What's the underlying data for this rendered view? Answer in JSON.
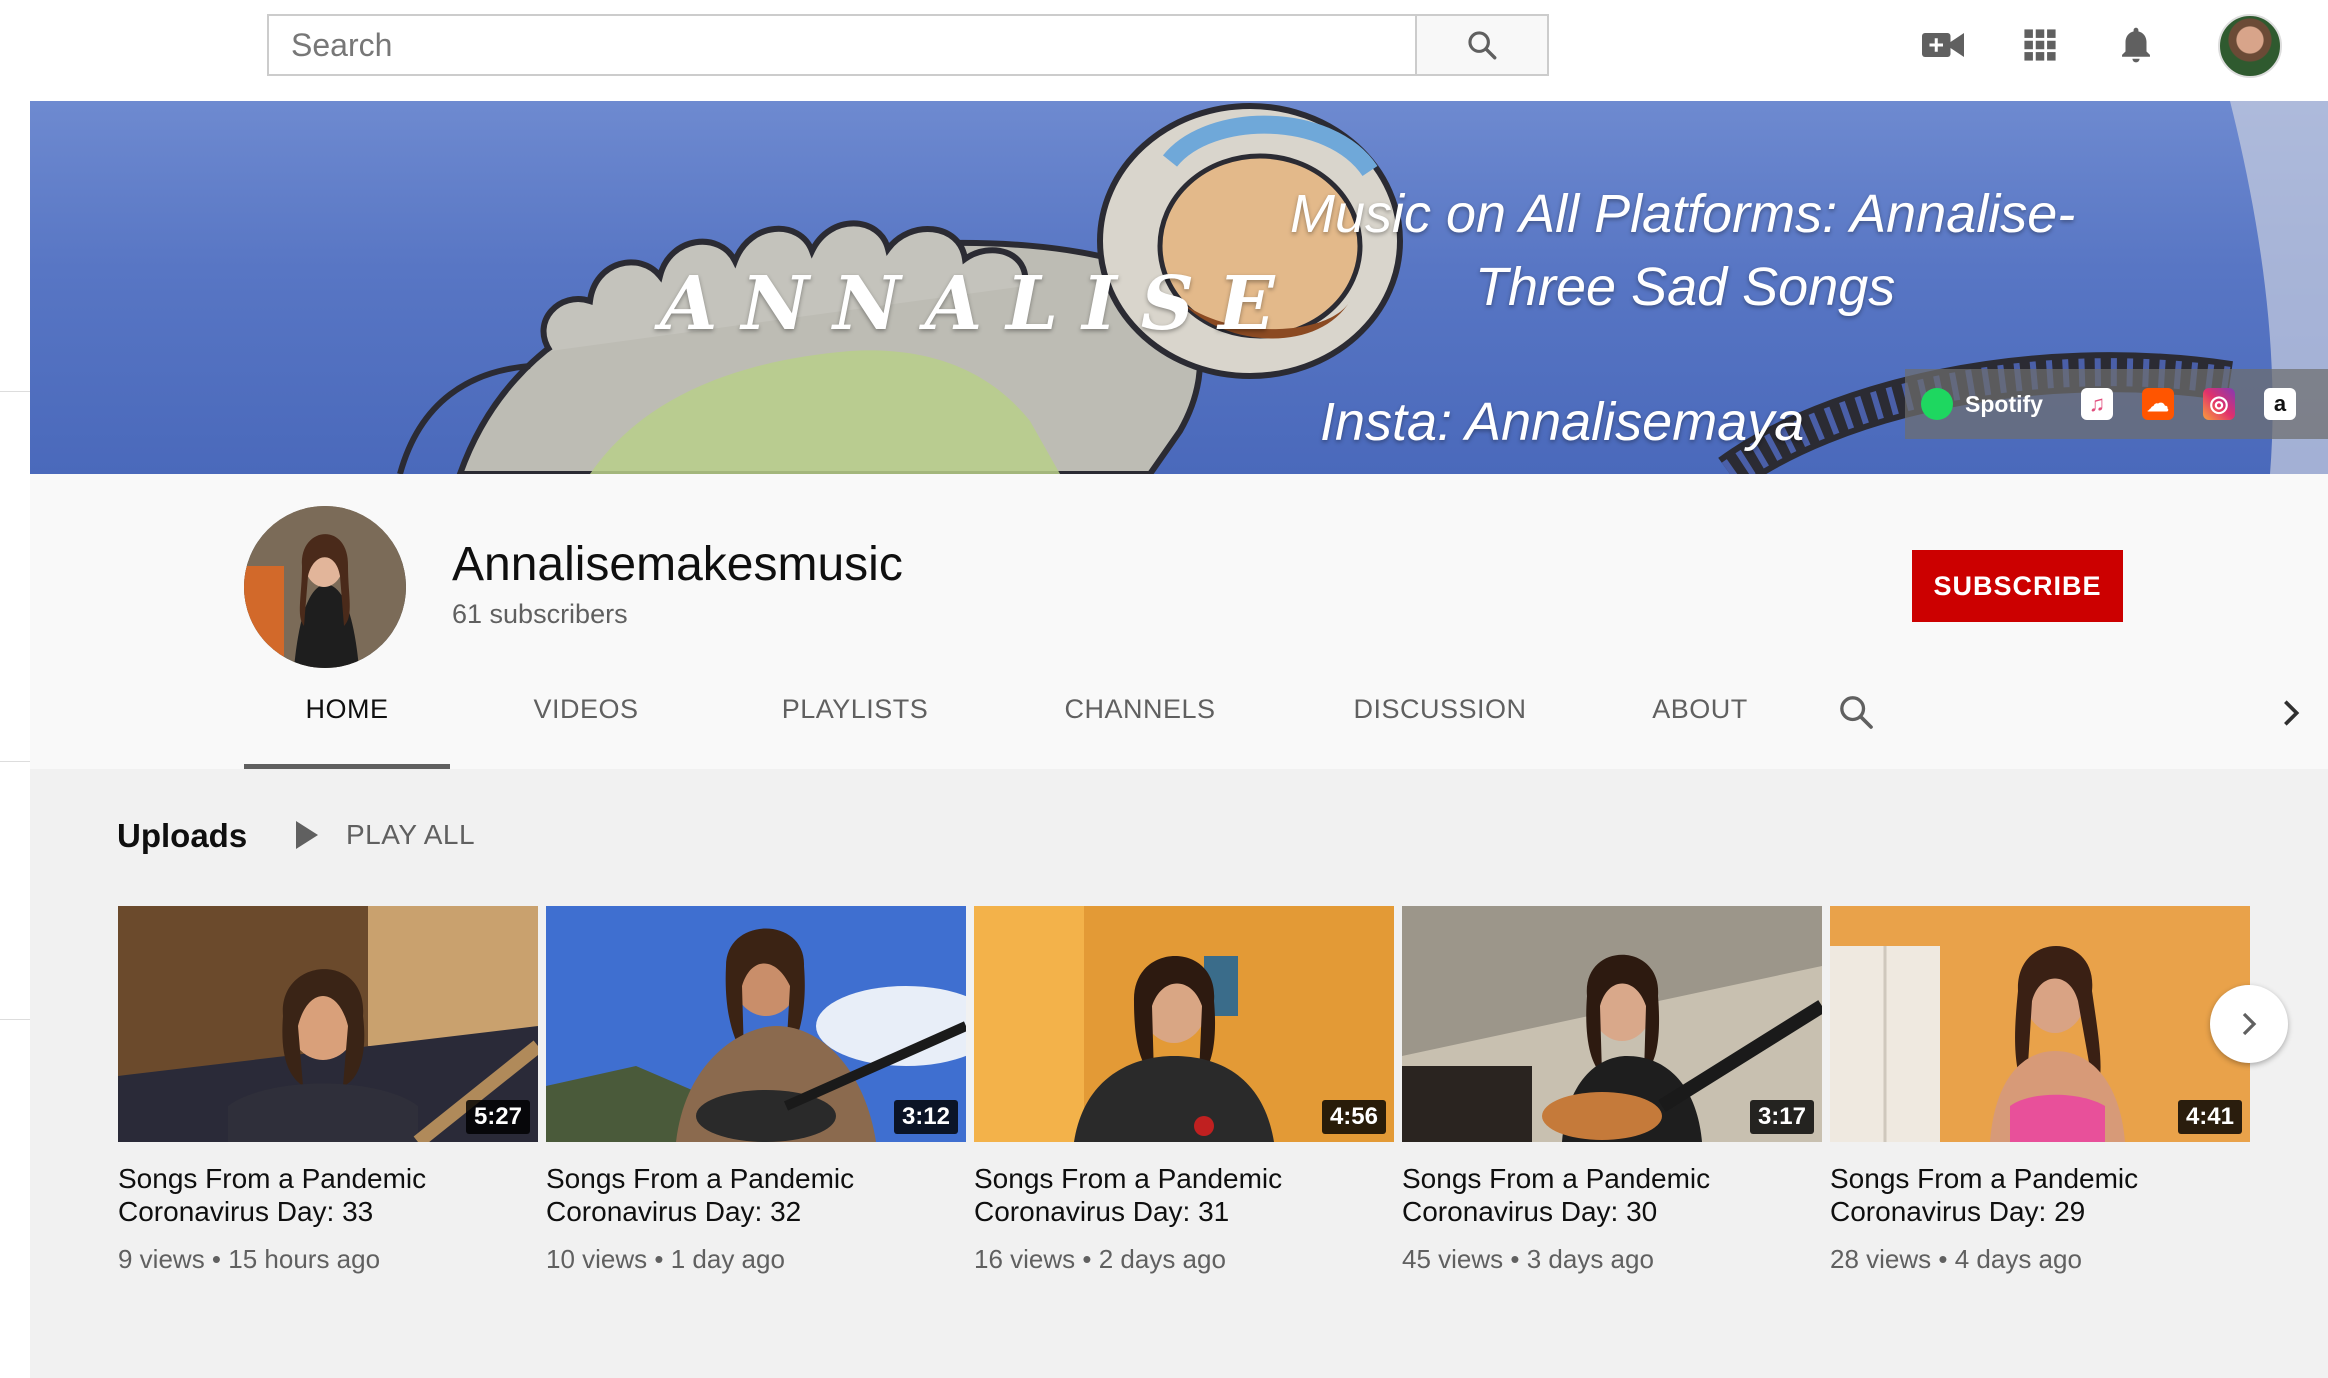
{
  "header": {
    "search_placeholder": "Search",
    "icons": [
      "search-icon",
      "create-video-icon",
      "apps-grid-icon",
      "notifications-bell-icon",
      "account-avatar"
    ]
  },
  "banner": {
    "title": "ANNALISE",
    "line1": "Music on All Platforms: Annalise-",
    "line2": "Three Sad Songs",
    "insta": "Insta: Annalisemaya",
    "links": {
      "spotify_label": "Spotify",
      "icons": [
        "spotify-icon",
        "apple-music-icon",
        "soundcloud-icon",
        "instagram-icon",
        "amazon-icon"
      ]
    }
  },
  "channel": {
    "name": "Annalisemakesmusic",
    "subscribers": "61 subscribers",
    "subscribe_label": "SUBSCRIBE"
  },
  "tabs": [
    {
      "label": "HOME",
      "active": true
    },
    {
      "label": "VIDEOS"
    },
    {
      "label": "PLAYLISTS"
    },
    {
      "label": "CHANNELS"
    },
    {
      "label": "DISCUSSION"
    },
    {
      "label": "ABOUT"
    }
  ],
  "uploads": {
    "title": "Uploads",
    "play_all": "PLAY ALL",
    "videos": [
      {
        "title": "Songs From a Pandemic Coronavirus Day: 33",
        "duration": "5:27",
        "views": "9 views",
        "age": "15 hours ago"
      },
      {
        "title": "Songs From a Pandemic Coronavirus Day: 32",
        "duration": "3:12",
        "views": "10 views",
        "age": "1 day ago"
      },
      {
        "title": "Songs From a Pandemic Coronavirus Day: 31",
        "duration": "4:56",
        "views": "16 views",
        "age": "2 days ago"
      },
      {
        "title": "Songs From a Pandemic Coronavirus Day: 30",
        "duration": "3:17",
        "views": "45 views",
        "age": "3 days ago"
      },
      {
        "title": "Songs From a Pandemic Coronavirus Day: 29",
        "duration": "4:41",
        "views": "28 views",
        "age": "4 days ago"
      }
    ],
    "meta_separator": " • "
  },
  "colors": {
    "subscribe_red": "#cc0000",
    "banner_blue": "#5876c4",
    "spotify_green": "#1ed760"
  }
}
